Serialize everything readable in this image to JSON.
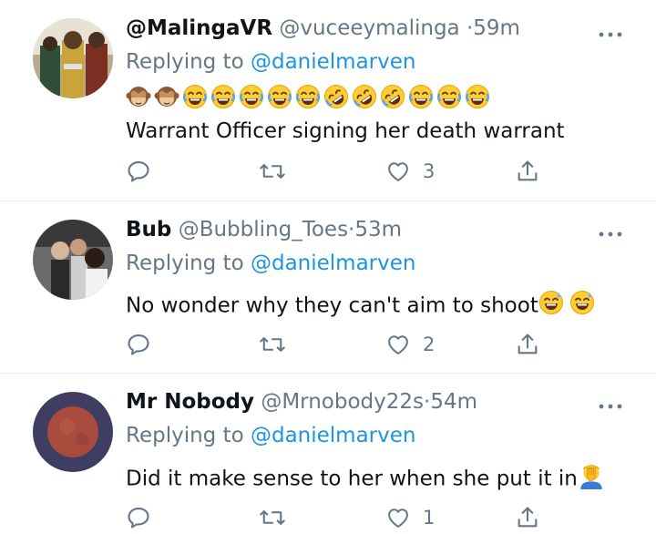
{
  "tweets": [
    {
      "name": "@MalingaVR",
      "handle": "@vuceeymalinga",
      "time": "59m",
      "replying_label": "Replying to",
      "replying_to": "@danielmarven",
      "emojis": [
        "see-no-evil-monkey",
        "see-no-evil-monkey",
        "joy",
        "joy",
        "joy",
        "joy",
        "joy",
        "rofl",
        "rofl",
        "rofl",
        "joy",
        "joy",
        "joy"
      ],
      "text": "Warrant Officer signing her death warrant",
      "likes": "3"
    },
    {
      "name": "Bub",
      "handle": "@Bubbling_Toes",
      "time": "53m",
      "replying_label": "Replying to",
      "replying_to": "@danielmarven",
      "text": "No wonder why they can't aim to shoot",
      "trailing_emojis": [
        "sweat-smile",
        "sweat-smile"
      ],
      "likes": "2"
    },
    {
      "name": "Mr Nobody",
      "handle": "@Mrnobody22s",
      "time": "54m",
      "replying_label": "Replying to",
      "replying_to": "@danielmarven",
      "text": "Did it make sense to her when she put it in",
      "trailing_emojis": [
        "facepalm"
      ],
      "likes": "1"
    }
  ],
  "icons": {
    "reply": "reply-icon",
    "retweet": "retweet-icon",
    "like": "heart-icon",
    "share": "share-icon",
    "more": "more-icon"
  },
  "colors": {
    "secondary_text": "#657786",
    "link": "#1b95e0",
    "divider": "#e6ecf0"
  }
}
